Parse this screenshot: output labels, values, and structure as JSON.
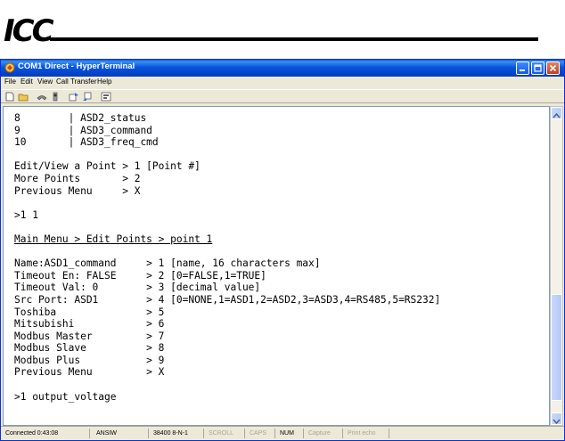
{
  "header": {
    "logo_text": "ICC"
  },
  "window": {
    "title": "COM1 Direct - HyperTerminal",
    "menu": [
      "File",
      "Edit",
      "View",
      "Call",
      "Transfer",
      "Help"
    ],
    "toolbar_icons": [
      "new-icon",
      "open-icon",
      "phone-icon",
      "disconnect-icon",
      "send-icon",
      "receive-icon",
      "properties-icon"
    ]
  },
  "terminal": {
    "lines": [
      {
        "text": "8        | ASD2_status"
      },
      {
        "text": "9        | ASD3_command"
      },
      {
        "text": "10       | ASD3_freq_cmd"
      },
      {
        "text": ""
      },
      {
        "text": "Edit/View a Point > 1 [Point #]"
      },
      {
        "text": "More Points       > 2"
      },
      {
        "text": "Previous Menu     > X"
      },
      {
        "text": ""
      },
      {
        "text": ">1 1"
      },
      {
        "text": ""
      },
      {
        "text": "Main Menu > Edit Points > point 1",
        "underline": true
      },
      {
        "text": ""
      },
      {
        "text": "Name:ASD1_command     > 1 [name, 16 characters max]"
      },
      {
        "text": "Timeout En: FALSE     > 2 [0=FALSE,1=TRUE]"
      },
      {
        "text": "Timeout Val: 0        > 3 [decimal value]"
      },
      {
        "text": "Src Port: ASD1        > 4 [0=NONE,1=ASD1,2=ASD2,3=ASD3,4=RS485,5=RS232]"
      },
      {
        "text": "Toshiba               > 5"
      },
      {
        "text": "Mitsubishi            > 6"
      },
      {
        "text": "Modbus Master         > 7"
      },
      {
        "text": "Modbus Slave          > 8"
      },
      {
        "text": "Modbus Plus           > 9"
      },
      {
        "text": "Previous Menu         > X"
      },
      {
        "text": ""
      },
      {
        "text": ">1 output_voltage"
      }
    ]
  },
  "statusbar": {
    "connected": "Connected 0:43:08",
    "emulation": "ANSIW",
    "port_settings": "38400 8-N-1",
    "scroll": "SCROLL",
    "caps": "CAPS",
    "num": "NUM",
    "capture": "Capture",
    "print_echo": "Print echo"
  },
  "colors": {
    "titlebar": "#0855dd",
    "chrome": "#ece9d8",
    "close_button": "#c4401c"
  }
}
